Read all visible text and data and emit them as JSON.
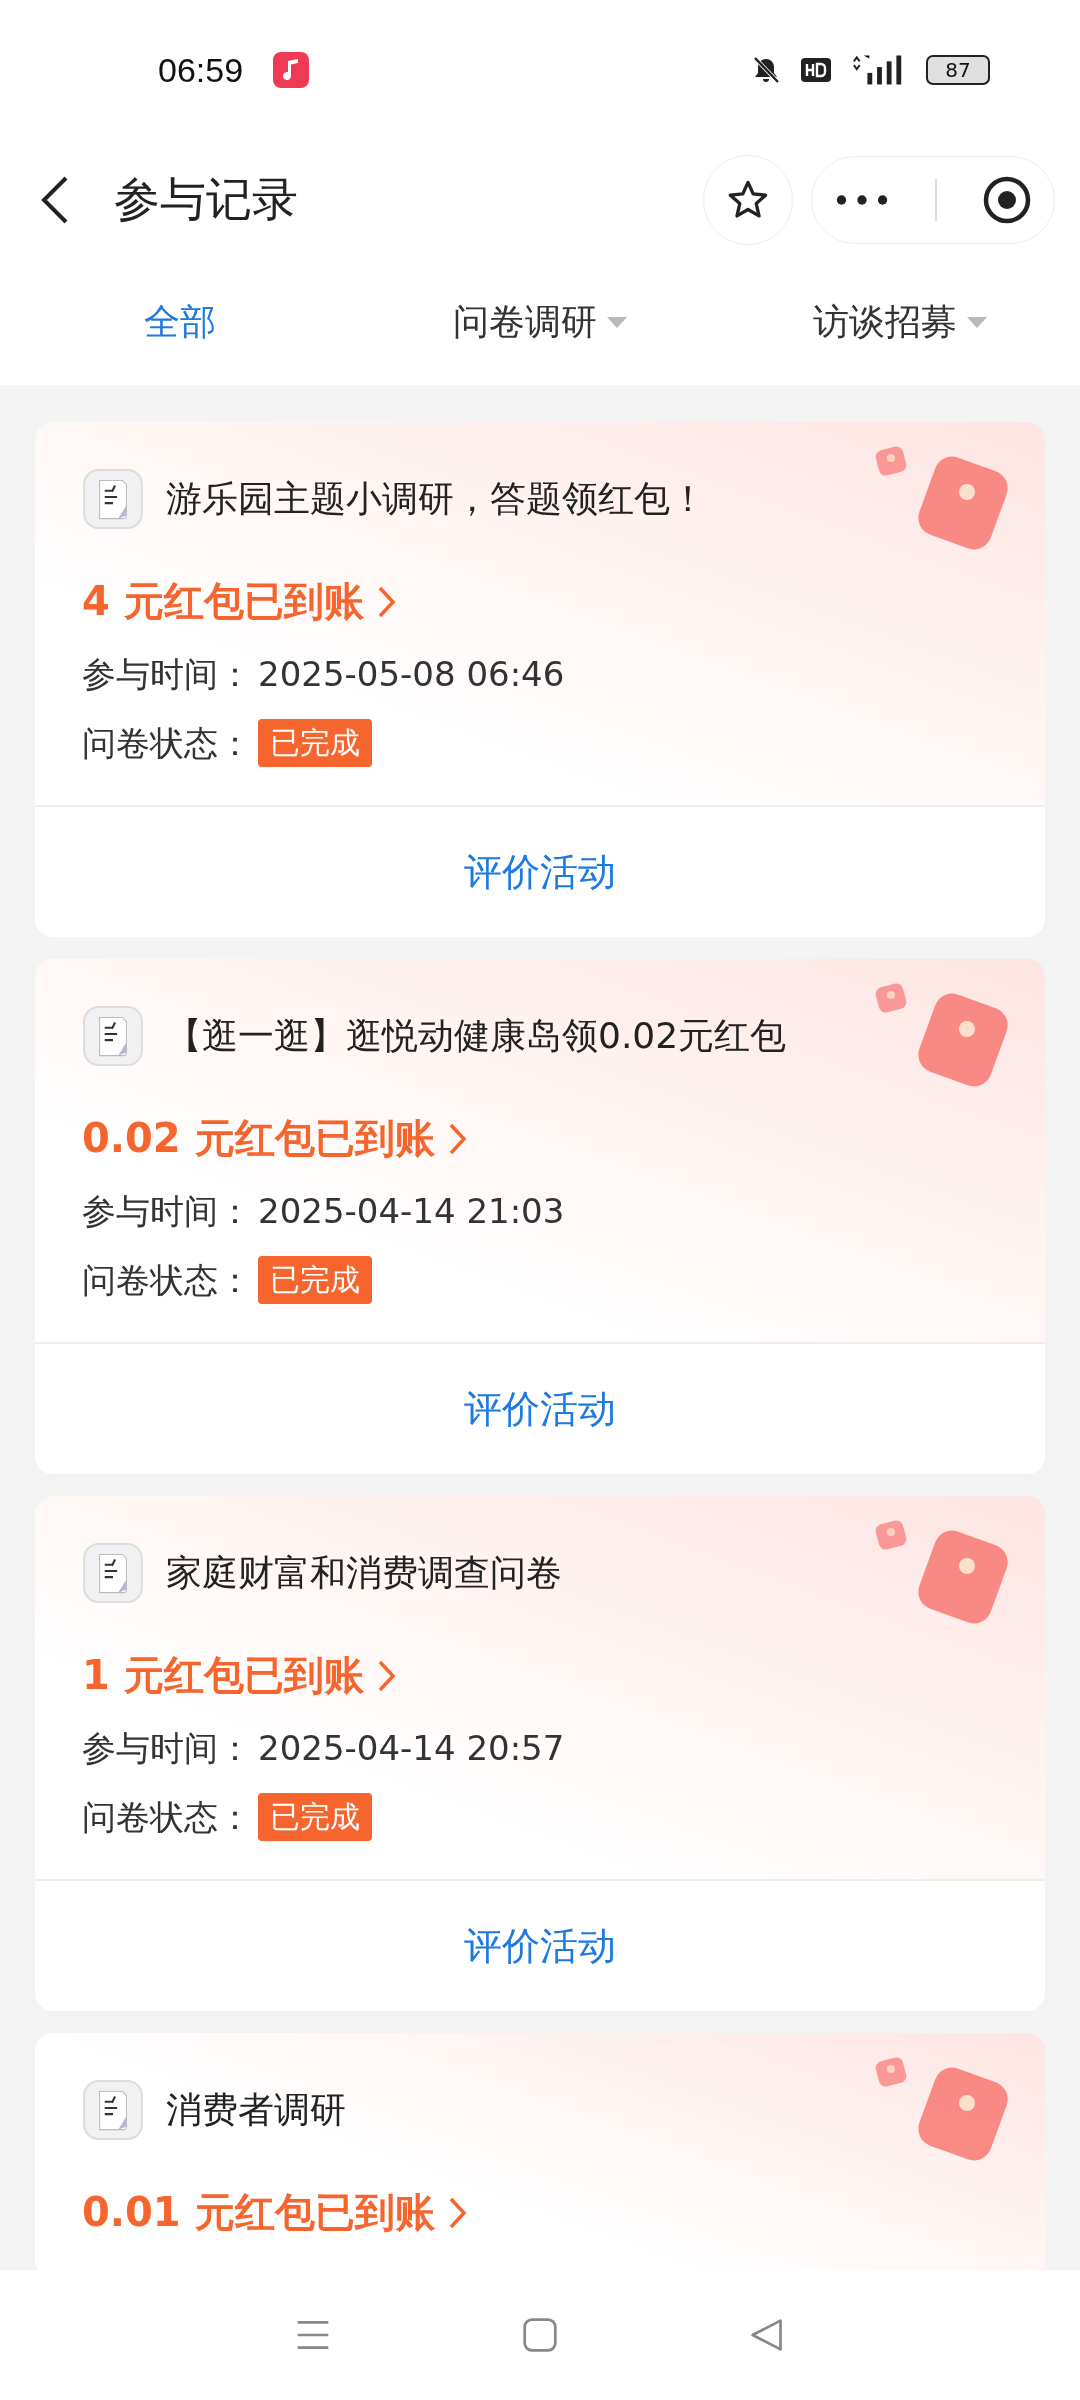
{
  "status_bar": {
    "time": "06:59",
    "battery": "87"
  },
  "header": {
    "title": "参与记录"
  },
  "tabs": [
    {
      "label": "全部",
      "selected": true,
      "dropdown": false
    },
    {
      "label": "问卷调研",
      "selected": false,
      "dropdown": true
    },
    {
      "label": "访谈招募",
      "selected": false,
      "dropdown": true
    }
  ],
  "records": [
    {
      "title": "游乐园主题小调研，答题领红包！",
      "reward": "4 元红包已到账",
      "time_label": "参与时间：",
      "time": "2025-05-08 06:46",
      "status_label": "问卷状态：",
      "status": "已完成",
      "action": "评价活动"
    },
    {
      "title": "【逛一逛】逛悦动健康岛领0.02元红包",
      "reward": "0.02 元红包已到账",
      "time_label": "参与时间：",
      "time": "2025-04-14 21:03",
      "status_label": "问卷状态：",
      "status": "已完成",
      "action": "评价活动"
    },
    {
      "title": "家庭财富和消费调查问卷",
      "reward": "1 元红包已到账",
      "time_label": "参与时间：",
      "time": "2025-04-14 20:57",
      "status_label": "问卷状态：",
      "status": "已完成",
      "action": "评价活动"
    },
    {
      "title": "消费者调研",
      "reward": "0.01 元红包已到账"
    }
  ]
}
